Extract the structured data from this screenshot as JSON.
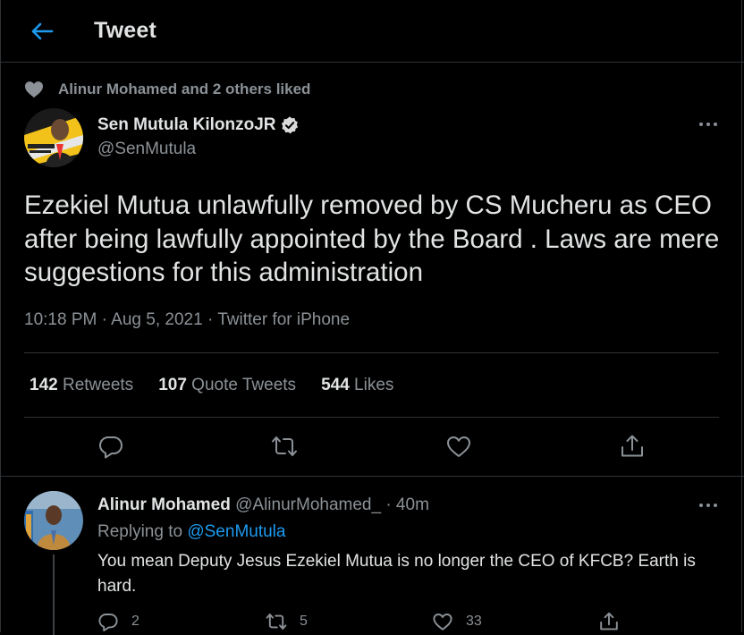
{
  "header": {
    "title": "Tweet",
    "back_icon": "arrow-left-icon",
    "accent": "#1d9bf0"
  },
  "social_context": {
    "text": "Alinur Mohamed and 2 others liked",
    "icon": "heart-icon"
  },
  "tweet": {
    "author_name": "Sen Mutula KilonzoJR",
    "handle": "@SenMutula",
    "verified": true,
    "avatar_caption": "Sen Mutula Kilonzo Jr",
    "text": "Ezekiel Mutua unlawfully removed by CS Mucheru  as CEO after being lawfully appointed by the Board . Laws are mere suggestions for this administration",
    "time": "10:18 PM",
    "date": "Aug 5, 2021",
    "source": "Twitter for iPhone",
    "separator": "·",
    "stats": {
      "retweets_count": "142",
      "retweets_label": "Retweets",
      "quotes_count": "107",
      "quotes_label": "Quote Tweets",
      "likes_count": "544",
      "likes_label": "Likes"
    }
  },
  "reply": {
    "author_name": "Alinur Mohamed",
    "handle": "@AlinurMohamed_",
    "time": "· 40m",
    "replying_prefix": "Replying to",
    "replying_to": "@SenMutula",
    "text": "You mean Deputy Jesus Ezekiel Mutua is no longer the CEO of KFCB? Earth is hard.",
    "counts": {
      "replies": "2",
      "retweets": "5",
      "likes": "33"
    }
  },
  "colors": {
    "background": "#000000",
    "text": "#e1e3e4",
    "muted": "#8b9196",
    "border": "#2f3336",
    "link": "#1d9bf0"
  }
}
